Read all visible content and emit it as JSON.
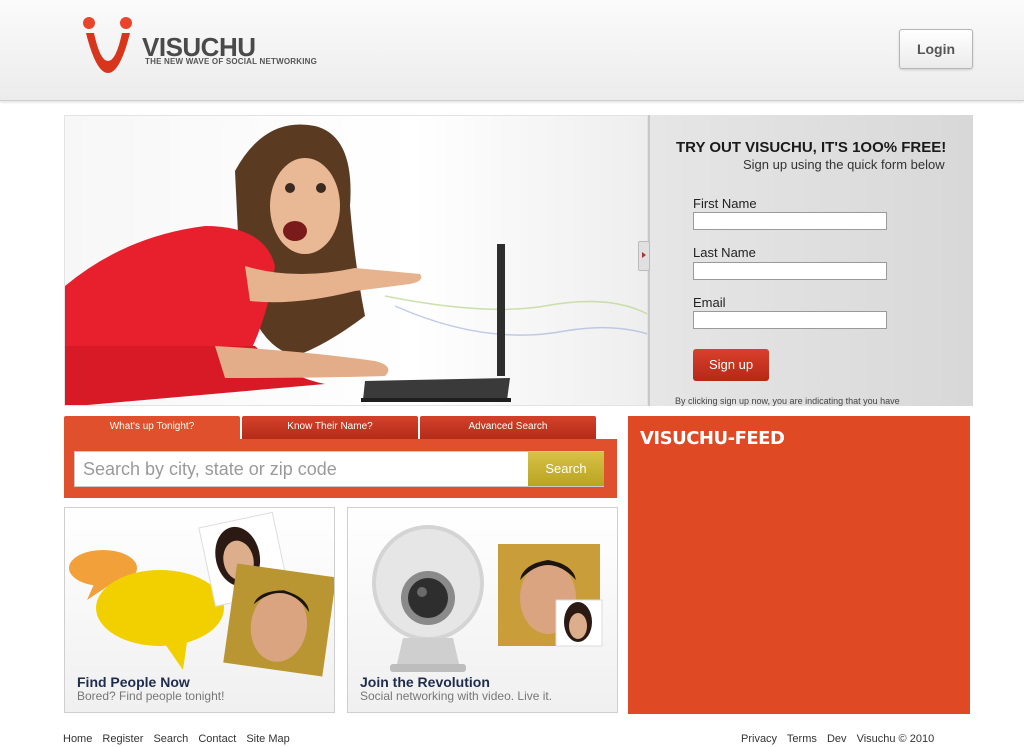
{
  "header": {
    "logo_text": "VISUCHU",
    "tagline": "THE NEW WAVE OF SOCIAL NETWORKING",
    "login_label": "Login"
  },
  "signup": {
    "title": "TRY OUT VISUCHU, IT'S 1OO% FREE!",
    "subtitle": "Sign up using the quick form below",
    "first_name_label": "First Name",
    "last_name_label": "Last Name",
    "email_label": "Email",
    "button_label": "Sign up",
    "note": "By clicking sign up now, you are indicating that you have"
  },
  "search": {
    "tabs": [
      "What's up Tonight?",
      "Know Their Name?",
      "Advanced Search"
    ],
    "placeholder": "Search by city, state or zip code",
    "button_label": "Search"
  },
  "cards": [
    {
      "title": "Find People Now",
      "subtitle": "Bored? Find people tonight!"
    },
    {
      "title": "Join the Revolution",
      "subtitle": "Social networking with video. Live it."
    }
  ],
  "feed": {
    "title": "VISUCHU-FEED"
  },
  "footer": {
    "left_links": [
      "Home",
      "Register",
      "Search",
      "Contact",
      "Site Map"
    ],
    "right_links": [
      "Privacy",
      "Terms",
      "Dev"
    ],
    "copyright": "Visuchu © 2010"
  },
  "colors": {
    "brand_red": "#df4a24",
    "search_button": "#c9b332",
    "signup_button": "#c8331f"
  }
}
